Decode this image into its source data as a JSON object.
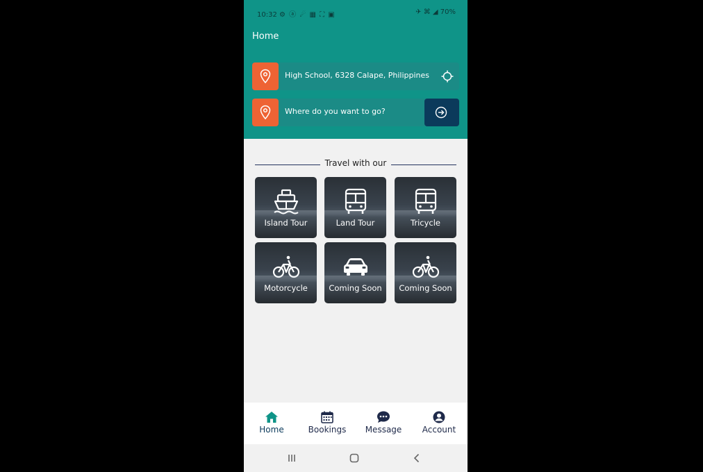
{
  "status_bar": {
    "time": "10:32",
    "left_icons": "⚙ ⓐ ☄ ▦ ⛶ ▣",
    "right_icons": "✈ ⌘ ◢",
    "battery": "70%"
  },
  "app": {
    "title": "Home"
  },
  "location": {
    "current": "High School, 6328 Calape, Philippines",
    "destination_placeholder": "Where do you want to go?"
  },
  "section": {
    "title": "Travel with our"
  },
  "services": [
    {
      "label": "Island Tour",
      "icon": "ship-icon"
    },
    {
      "label": "Land Tour",
      "icon": "bus-icon"
    },
    {
      "label": "Tricycle",
      "icon": "bus-icon"
    },
    {
      "label": "Motorcycle",
      "icon": "bicycle-icon"
    },
    {
      "label": "Coming Soon",
      "icon": "car-icon"
    },
    {
      "label": "Coming Soon",
      "icon": "bicycle-icon"
    }
  ],
  "bottom_nav": [
    {
      "label": "Home",
      "icon": "home-icon",
      "active": true
    },
    {
      "label": "Bookings",
      "icon": "calendar-icon",
      "active": false
    },
    {
      "label": "Message",
      "icon": "chat-icon",
      "active": false
    },
    {
      "label": "Account",
      "icon": "account-icon",
      "active": false
    }
  ],
  "colors": {
    "header": "#0f9488",
    "pin": "#ee6334",
    "go_button": "#0b3a5b",
    "active_nav": "#0f9488"
  }
}
